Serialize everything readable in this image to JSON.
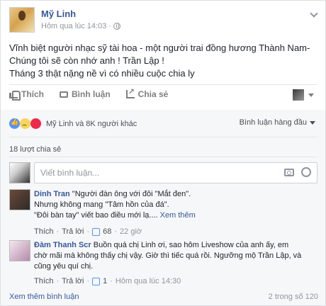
{
  "post": {
    "author": "Mỹ Linh",
    "time": "Hôm qua lúc 14:03",
    "lines": [
      "Vĩnh biệt người nhạc sỹ tài hoa - một người trai đồng hương Thành Nam-",
      "Chúng tôi sẽ còn nhớ anh ! Trần Lập !",
      "Tháng 3 thật nặng nề vì có nhiều cuộc chia ly"
    ]
  },
  "actions": {
    "like": "Thích",
    "comment": "Bình luận",
    "share": "Chia sẻ"
  },
  "reactions": {
    "summary": "Mỹ Linh và 8K người khác",
    "sort_label": "Bình luận hàng đầu"
  },
  "shares": "18 lượt chia sẻ",
  "composer": {
    "placeholder": "Viết bình luận..."
  },
  "comments": [
    {
      "name": "Dinh Tran",
      "lines": [
        "\"Người đàn ông với đôi \"Mắt đen\".",
        "Nhưng không mang \"Tâm hồn của đá\".",
        "\"Đôi bàn tay\" viết bao điều mới lạ...."
      ],
      "see_more": "Xem thêm",
      "like": "Thích",
      "reply": "Trả lời",
      "likes": "68",
      "time": "22 giờ"
    },
    {
      "name": "Đàm Thanh Sơn",
      "name_display": "Đàm Thanh Scr",
      "lines": [
        "Buồn quá chị Linh ơi, sao hôm Liveshow của anh ấy, em",
        "chờ mãi mà không thấy chị vậy. Giờ thì tiếc quá rồi. Ngưỡng mộ Trần Lập, và",
        "cũng yêu quí chị."
      ],
      "like": "Thích",
      "reply": "Trả lời",
      "likes": "1",
      "time": "Hôm qua lúc 14:30"
    }
  ],
  "footer": {
    "more_comments": "Xem thêm bình luận",
    "count": "2 trong số 120"
  },
  "colors": {
    "link": "#365899",
    "muted": "#90949c",
    "like_blue": "#5890ff"
  }
}
